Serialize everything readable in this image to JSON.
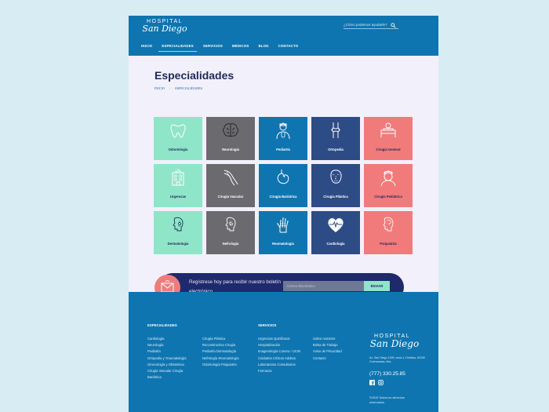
{
  "header": {
    "logo_top": "HOSPITAL",
    "logo_bottom": "San Diego",
    "search_placeholder": "¿Cómo podemos ayudarle?",
    "nav": [
      {
        "label": "INICIO",
        "active": false
      },
      {
        "label": "ESPECIALIDADES",
        "active": true
      },
      {
        "label": "SERVICIOS",
        "active": false
      },
      {
        "label": "MÉDICOS",
        "active": false
      },
      {
        "label": "BLOG",
        "active": false
      },
      {
        "label": "CONTACTO",
        "active": false
      }
    ]
  },
  "page": {
    "title": "Especialidades",
    "breadcrumb": [
      "INICIO",
      "/",
      "ESPECIALIDADES"
    ]
  },
  "specialties": [
    {
      "label": "Odontología",
      "color": "#8fe5c8",
      "icon": "tooth-icon"
    },
    {
      "label": "Neurología",
      "color": "#6b6b6f",
      "icon": "brain-icon"
    },
    {
      "label": "Pediatría",
      "color": "#0f75b0",
      "icon": "doctor-icon"
    },
    {
      "label": "Ortopedia",
      "color": "#2d4c86",
      "icon": "knee-icon"
    },
    {
      "label": "Cirugía General",
      "color": "#f17b7b",
      "icon": "bed-icon"
    },
    {
      "label": "Urgencias",
      "color": "#8fe5c8",
      "icon": "hospital-building-icon"
    },
    {
      "label": "Cirugía Vascular",
      "color": "#6b6b6f",
      "icon": "leg-veins-icon"
    },
    {
      "label": "Cirugía Bariátrica",
      "color": "#0f75b0",
      "icon": "stomach-icon"
    },
    {
      "label": "Cirugía Plástica",
      "color": "#2d4c86",
      "icon": "face-icon"
    },
    {
      "label": "Cirugía Pediátrica",
      "color": "#f17b7b",
      "icon": "nurse-icon"
    },
    {
      "label": "Dermatología",
      "color": "#8fe5c8",
      "icon": "skin-face-icon"
    },
    {
      "label": "Nefrología",
      "color": "#6b6b6f",
      "icon": "kidney-head-icon"
    },
    {
      "label": "Reumatología",
      "color": "#0f75b0",
      "icon": "hand-bones-icon"
    },
    {
      "label": "Cardiología",
      "color": "#2d4c86",
      "icon": "heart-pulse-icon"
    },
    {
      "label": "Psiquiatría",
      "color": "#f17b7b",
      "icon": "head-icon"
    }
  ],
  "newsletter": {
    "text": "Regístrese hoy para recibir nuestro boletín electrónico",
    "placeholder": "Correo Electrónico",
    "button": "ENVIAR"
  },
  "footer": {
    "col1_title": "ESPECIALIDADES",
    "col1": [
      "Cardiología",
      "Neurología",
      "Pediatría",
      "Ortopedia y Traumatología",
      "Ginecología y Obstetricia",
      "Cirugía Vascular Cirugía",
      "Bariátrica"
    ],
    "col2": [
      "Cirugía Plástica",
      "Reconstructiva Cirugía",
      "Pediatría Dermatología",
      "Nefrología Reumatología",
      "Odontología Psiquiatría"
    ],
    "col3_title": "SERVICIOS",
    "col3": [
      "Urgencias Quirófanos",
      "Hospitalización",
      "Imagenología Cunero / UCIN",
      "Cuidados Críticos Adultos",
      "Laboratorios Consultorios",
      "Farmacia"
    ],
    "col4": [
      "Sobre nosotros",
      "Bolsa de Trabajo",
      "Aviso de Privacidad",
      "Contacto"
    ],
    "logo_top": "HOSPITAL",
    "logo_bottom": "San Diego",
    "address": "Av. San Diego 1305, zona 1, Delicias, 62330 Cuernavaca, Mor.",
    "phone": "(777) 330.25.85",
    "copyright": "©2019 Todos los derechos reservados."
  }
}
